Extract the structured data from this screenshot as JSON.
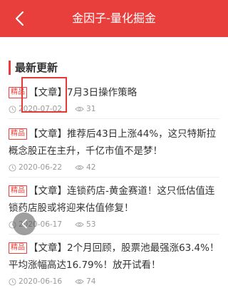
{
  "header": {
    "title": "金因子-量化掘金",
    "back_icon": "chevron-left-icon"
  },
  "section": {
    "title": "最新更新"
  },
  "articles": [
    {
      "badge": "精品",
      "type": "【文章】",
      "title": "7月3日操作策略",
      "date": "2020-07-02",
      "views": "31"
    },
    {
      "badge": "精品",
      "type": "【文章】",
      "title": "推荐后43日上涨44%，这只特斯拉概念股正在主升，千亿市值不是梦！",
      "date": "2020-06-22",
      "views": "42"
    },
    {
      "badge": "精品",
      "type": "【文章】",
      "title": "连锁药店-黄金赛道！这只低估值连锁药店股或将迎来估值修复！",
      "date": "2020-06-17",
      "views": "53"
    },
    {
      "badge": "精品",
      "type": "【文章】",
      "title": "2个月回顾，股票池最强涨63.4%！平均涨幅高达16.79%！放开试看！",
      "date": "2020-06-16",
      "views": "74"
    }
  ],
  "colors": {
    "brand": "#e83f3c",
    "highlight": "#e53935"
  }
}
